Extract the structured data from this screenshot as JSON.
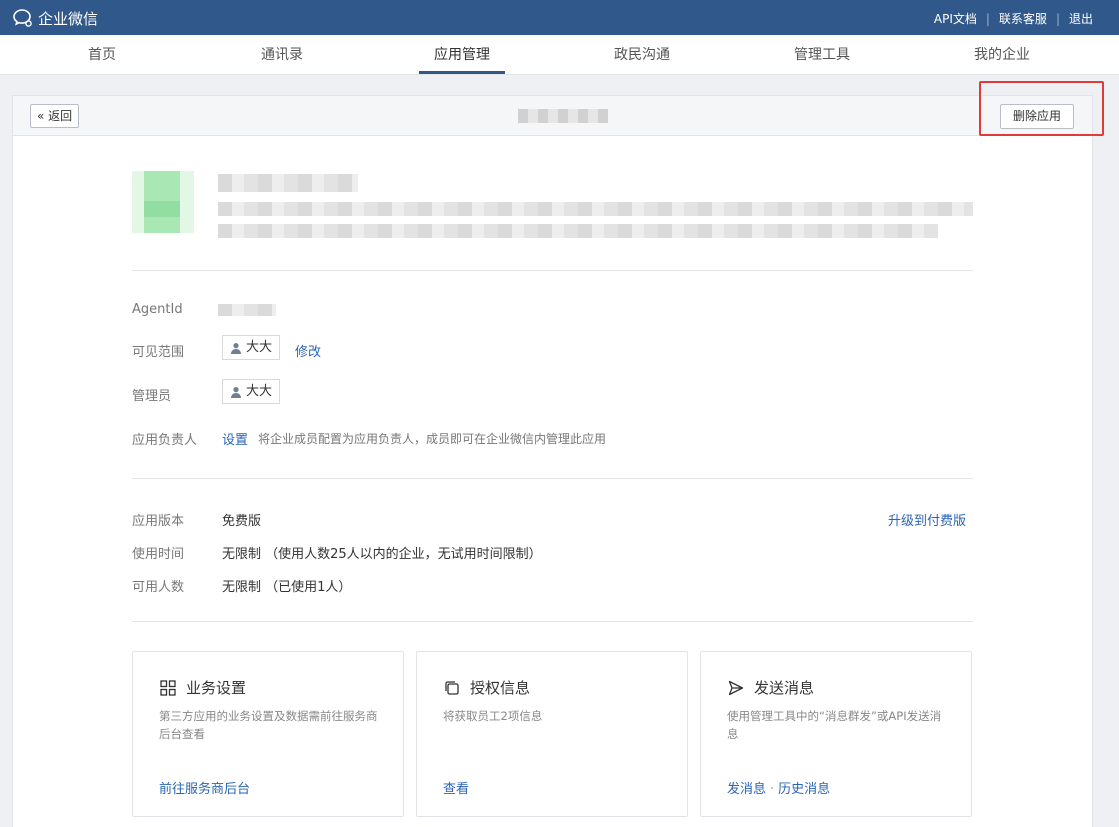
{
  "topbar": {
    "brand": "企业微信",
    "links": [
      "API文档",
      "联系客服",
      "退出"
    ]
  },
  "nav": {
    "items": [
      {
        "label": "首页",
        "active": false
      },
      {
        "label": "通讯录",
        "active": false
      },
      {
        "label": "应用管理",
        "active": true
      },
      {
        "label": "政民沟通",
        "active": false
      },
      {
        "label": "管理工具",
        "active": false
      },
      {
        "label": "我的企业",
        "active": false
      }
    ]
  },
  "panel": {
    "back_label": "返回",
    "delete_label": "删除应用"
  },
  "details": {
    "agentid_label": "AgentId",
    "visible_label": "可见范围",
    "visible_member": "大大",
    "visible_edit": "修改",
    "admin_label": "管理员",
    "admin_member": "大大",
    "owner_label": "应用负责人",
    "owner_set": "设置",
    "owner_desc": "将企业成员配置为应用负责人，成员即可在企业微信内管理此应用"
  },
  "license": {
    "version_label": "应用版本",
    "version_value": "免费版",
    "upgrade": "升级到付费版",
    "time_label": "使用时间",
    "time_value": "无限制 （使用人数25人以内的企业，无试用时间限制）",
    "users_label": "可用人数",
    "users_value": "无限制 （已使用1人）"
  },
  "cards": [
    {
      "title": "业务设置",
      "icon": "grid-icon",
      "desc": "第三方应用的业务设置及数据需前往服务商后台查看",
      "links": [
        "前往服务商后台"
      ]
    },
    {
      "title": "授权信息",
      "icon": "copy-icon",
      "desc": "将获取员工2项信息",
      "links": [
        "查看"
      ]
    },
    {
      "title": "发送消息",
      "icon": "send-icon",
      "desc": "使用管理工具中的“消息群发”或API发送消息",
      "links": [
        "发消息",
        "历史消息"
      ]
    }
  ],
  "colors": {
    "topbar": "#31588a",
    "link": "#2a65b6",
    "highlight": "#e03b3b"
  }
}
